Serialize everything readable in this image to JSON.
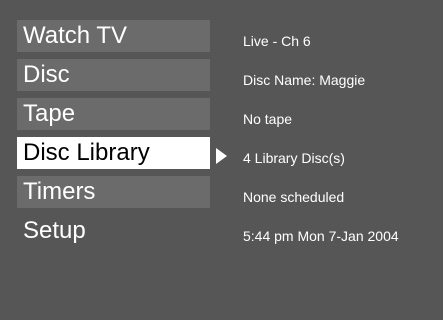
{
  "menu": {
    "items": [
      {
        "label": "Watch TV"
      },
      {
        "label": "Disc"
      },
      {
        "label": "Tape"
      },
      {
        "label": "Disc Library"
      },
      {
        "label": "Timers"
      },
      {
        "label": "Setup"
      }
    ],
    "selected_index": 3
  },
  "info": {
    "lines": [
      "Live - Ch 6",
      "Disc Name: Maggie",
      "No tape",
      "4 Library Disc(s)",
      "None scheduled",
      "5:44 pm Mon 7-Jan 2004"
    ]
  },
  "colors": {
    "background": "#565656",
    "item_bg": "#6b6b6b",
    "selected_bg": "#ffffff",
    "text": "#ffffff",
    "selected_text": "#000000"
  }
}
